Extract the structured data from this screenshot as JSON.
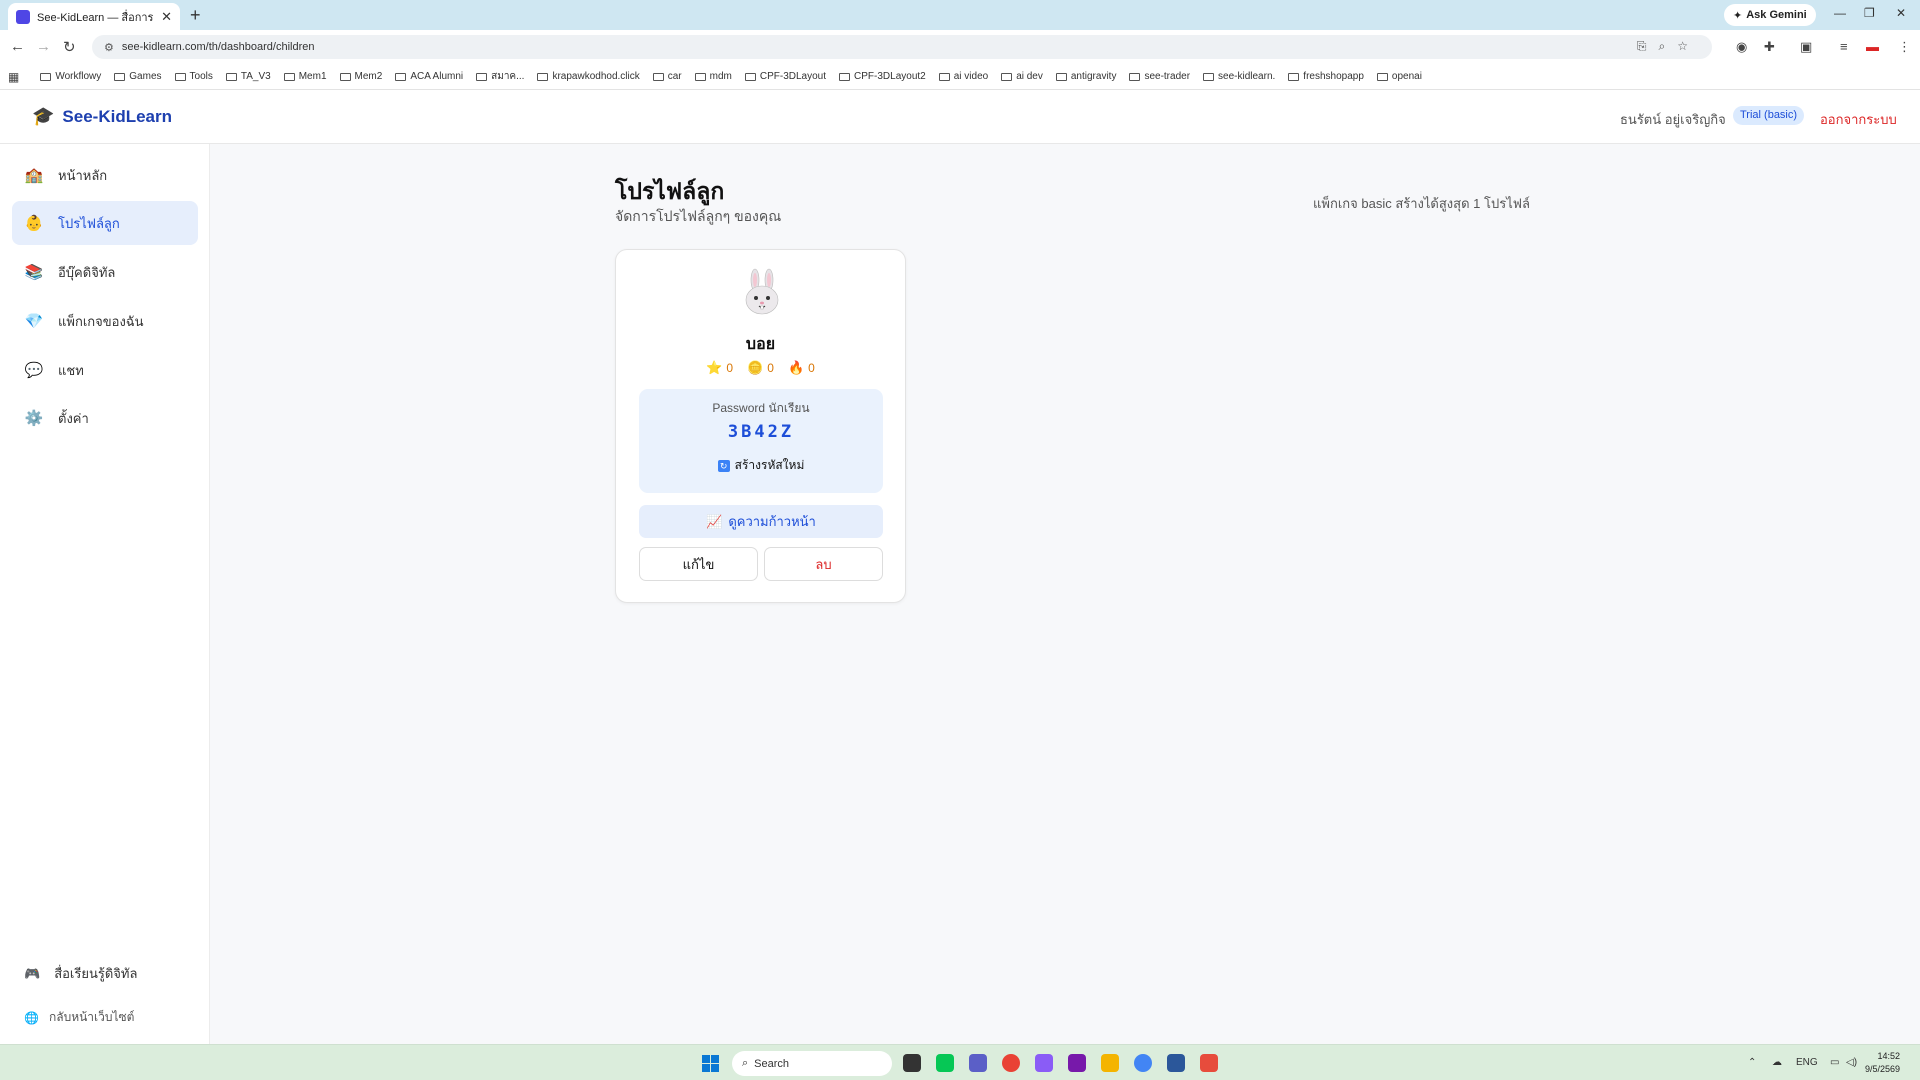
{
  "browser": {
    "tab_title": "See-KidLearn — สื่อการเรียนรู้ดิจิทัล",
    "tab_close": "✕",
    "new_tab": "+",
    "gemini_label": "Ask Gemini",
    "url": "see-kidlearn.com/th/dashboard/children",
    "bookmarks": [
      "Workflowy",
      "Games",
      "Tools",
      "TA_V3",
      "Mem1",
      "Mem2",
      "ACA Alumni",
      "สมาค...",
      "krapawkodhod.click",
      "car",
      "mdm",
      "CPF-3DLayout",
      "CPF-3DLayout2",
      "ai video",
      "ai dev",
      "antigravity",
      "see-trader",
      "see-kidlearn.",
      "freshshopapp",
      "openai"
    ]
  },
  "header": {
    "logo_icon": "🎓",
    "logo_text": "See-KidLearn",
    "user_name": "ธนรัตน์ อยู่เจริญกิจ",
    "plan_badge": "Trial (basic)",
    "logout": "ออกจากระบบ"
  },
  "sidebar": {
    "items": [
      {
        "icon": "🏫",
        "label": "หน้าหลัก",
        "active": false
      },
      {
        "icon": "👶",
        "label": "โปรไฟล์ลูก",
        "active": true
      },
      {
        "icon": "📚",
        "label": "อีบุ๊คดิจิทัล",
        "active": false
      },
      {
        "icon": "💎",
        "label": "แพ็กเกจของฉัน",
        "active": false
      },
      {
        "icon": "💬",
        "label": "แชท",
        "active": false
      },
      {
        "icon": "⚙️",
        "label": "ตั้งค่า",
        "active": false
      }
    ],
    "bottom": [
      {
        "icon": "🎮",
        "label": "สื่อเรียนรู้ดิจิทัล"
      },
      {
        "icon": "🌐",
        "label": "กลับหน้าเว็บไซต์"
      }
    ]
  },
  "main": {
    "title": "โปรไฟล์ลูก",
    "subtitle": "จัดการโปรไฟล์ลูกๆ ของคุณ",
    "limit_note": "แพ็กเกจ basic สร้างได้สูงสุด 1 โปรไฟล์",
    "child": {
      "name": "บอย",
      "stats": [
        {
          "icon": "⭐",
          "value": "0"
        },
        {
          "icon": "🪙",
          "value": "0"
        },
        {
          "icon": "🔥",
          "value": "0"
        }
      ],
      "password_label": "Password นักเรียน",
      "password": "3B42Z",
      "regen_label": "สร้างรหัสใหม่",
      "progress_label": "ดูความก้าวหน้า",
      "edit_label": "แก้ไข",
      "delete_label": "ลบ"
    }
  },
  "taskbar": {
    "search_label": "Search",
    "lang": "ENG",
    "time": "14:52",
    "date": "9/5/2569"
  },
  "colors": {
    "brand": "#1e40af",
    "accent_bg": "#e6eefc",
    "danger": "#dc2626"
  }
}
